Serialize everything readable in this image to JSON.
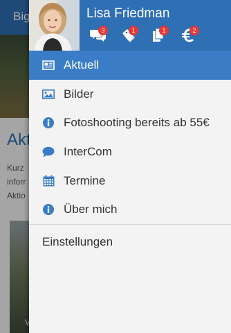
{
  "background": {
    "header_title": "Big",
    "heading": "Akt",
    "text_lines": [
      "Kurz",
      "inforr",
      "Aktio"
    ],
    "caption": "V"
  },
  "profile": {
    "name": "Lisa Friedman",
    "badges": [
      {
        "icon": "chat-bubbles-icon",
        "count": "3"
      },
      {
        "icon": "tag-icon",
        "count": "1"
      },
      {
        "icon": "documents-icon",
        "count": "1"
      },
      {
        "icon": "euro-icon",
        "count": "2"
      }
    ]
  },
  "menu": {
    "items": [
      {
        "label": "Aktuell",
        "icon": "newspaper-icon",
        "active": true
      },
      {
        "label": "Bilder",
        "icon": "image-icon"
      },
      {
        "label": "Fotoshooting bereits ab 55€",
        "icon": "info-icon"
      },
      {
        "label": "InterCom",
        "icon": "chat-icon"
      },
      {
        "label": "Termine",
        "icon": "calendar-icon"
      },
      {
        "label": "Über mich",
        "icon": "info-icon"
      }
    ],
    "settings_label": "Einstellungen"
  },
  "colors": {
    "brand": "#2f6fb3",
    "active": "#3a7cc5",
    "icon": "#3a7cc5",
    "badge": "#e53935"
  }
}
